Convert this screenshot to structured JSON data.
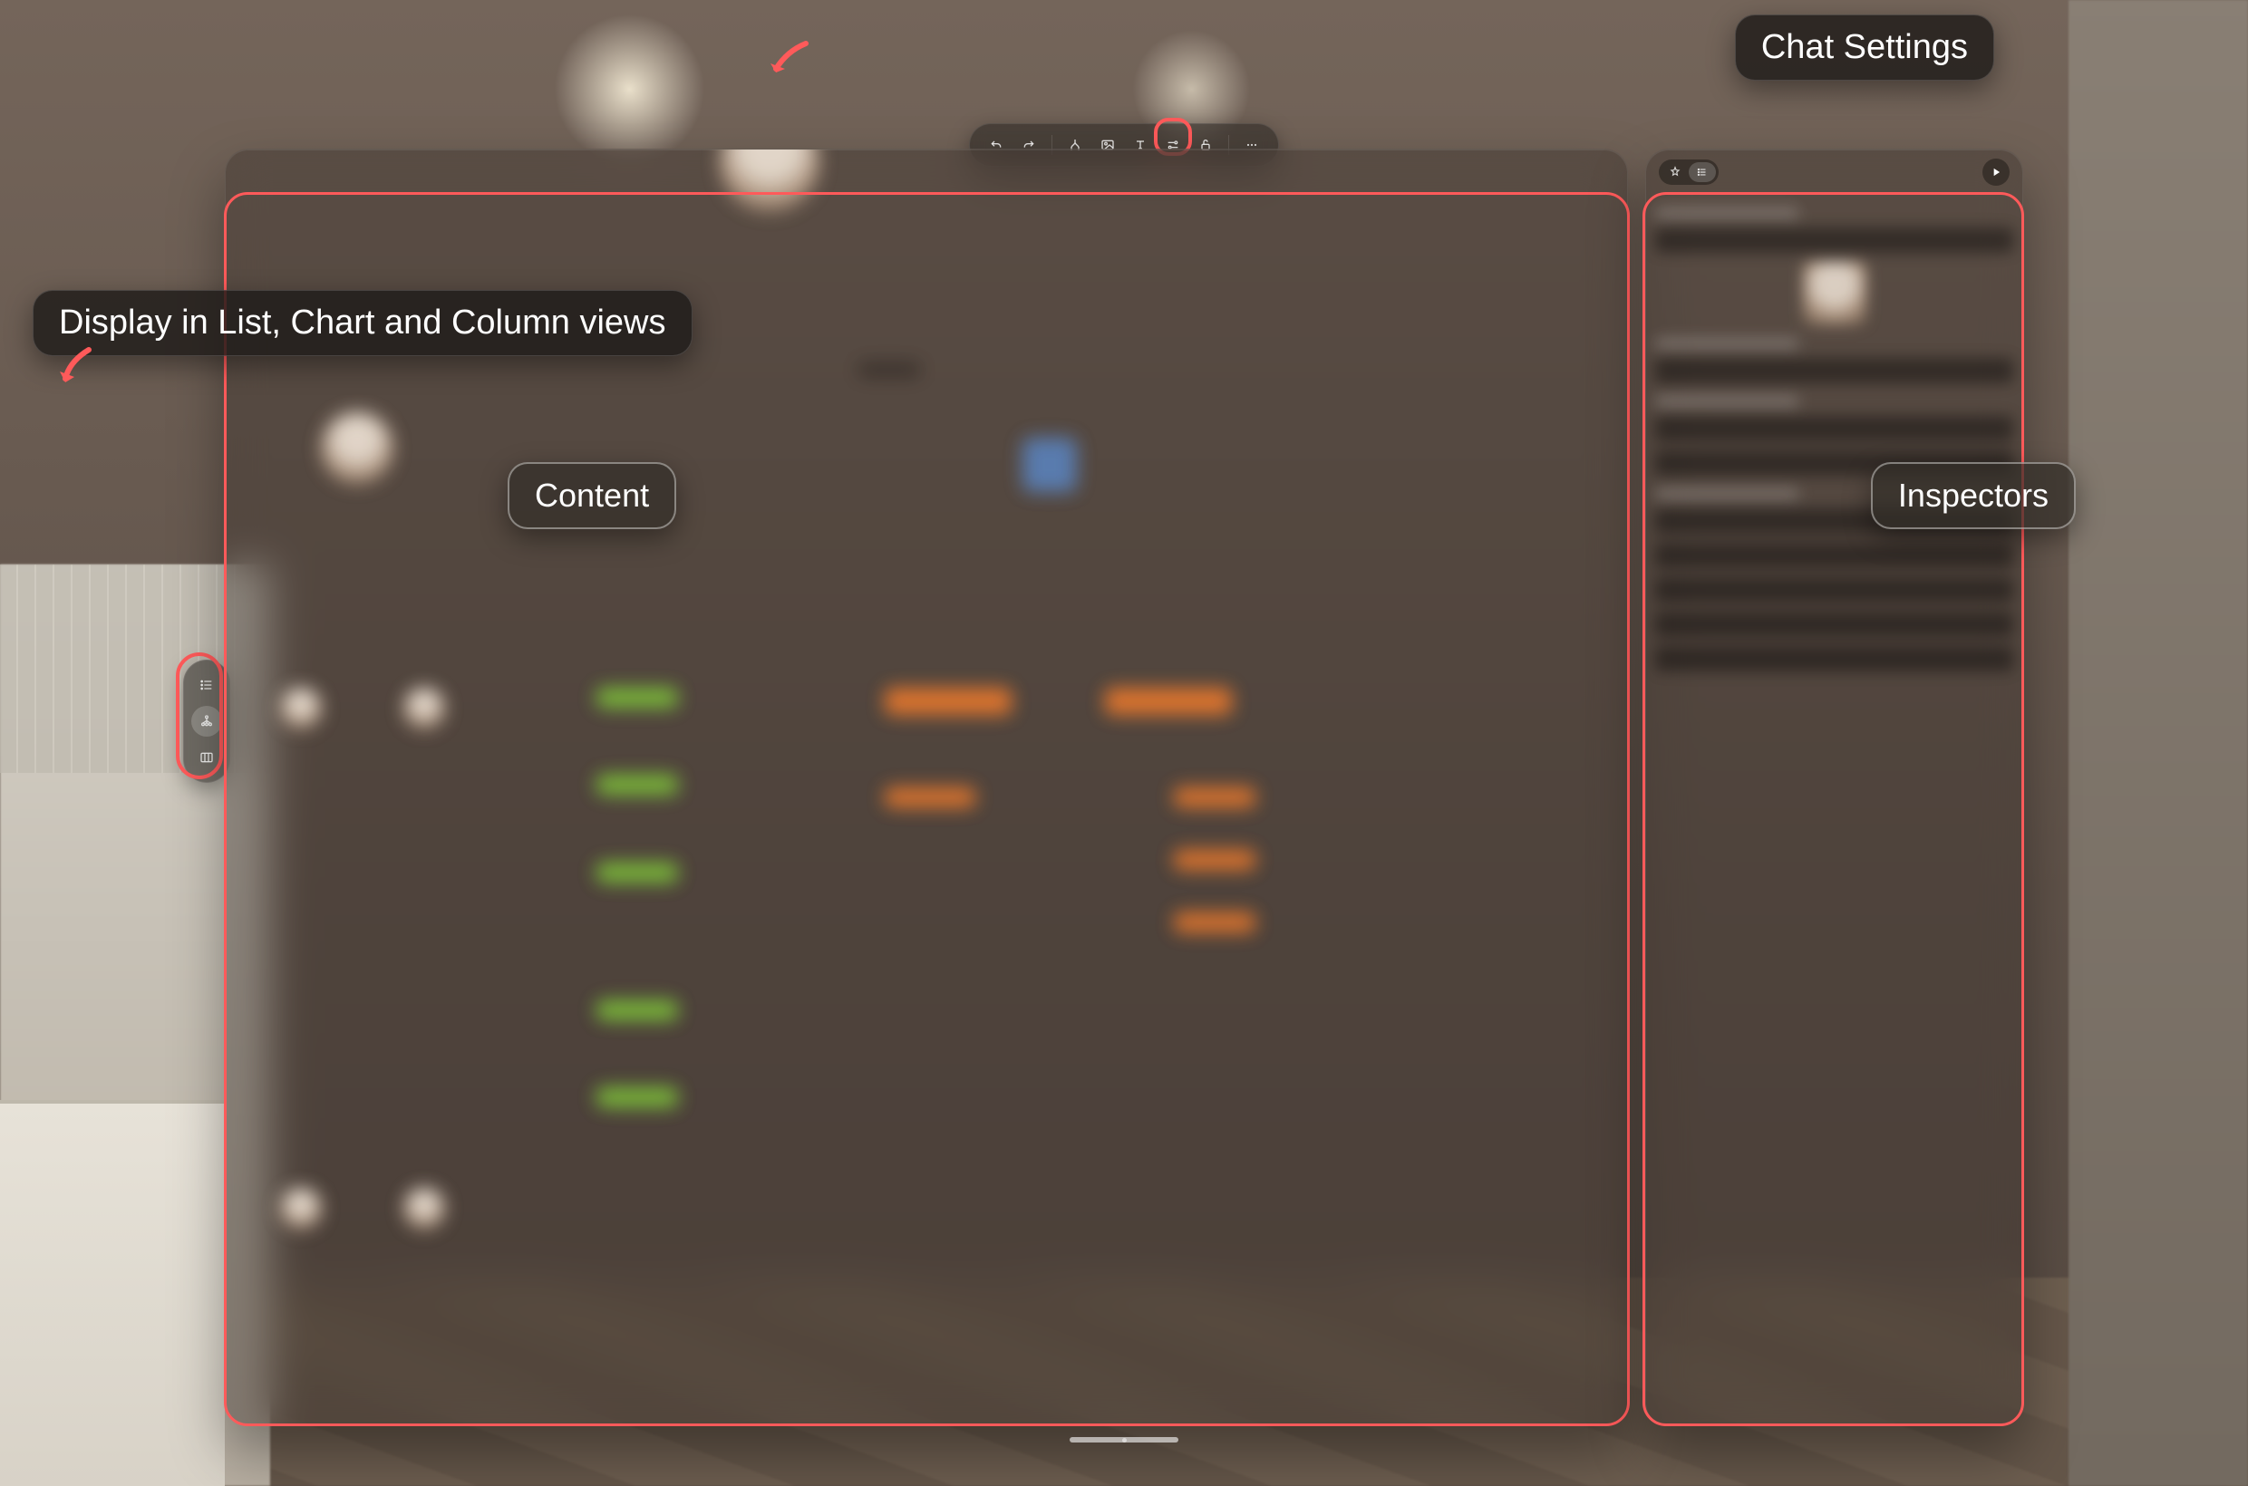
{
  "callouts": {
    "chat_settings": "Chat Settings",
    "views": "Display in List, Chart and Column views",
    "content_region": "Content",
    "inspectors_region": "Inspectors"
  },
  "toolbar": {
    "undo": "Undo",
    "redo": "Redo",
    "layout": "Layout",
    "image": "Image",
    "text": "Text",
    "settings": "Chat Settings",
    "lock": "Lock",
    "more": "More"
  },
  "view_switch": {
    "list": "List View",
    "chart": "Chart View",
    "column": "Column View"
  },
  "inspector": {
    "tab_info": "Info",
    "tab_list": "List",
    "play": "Play"
  }
}
